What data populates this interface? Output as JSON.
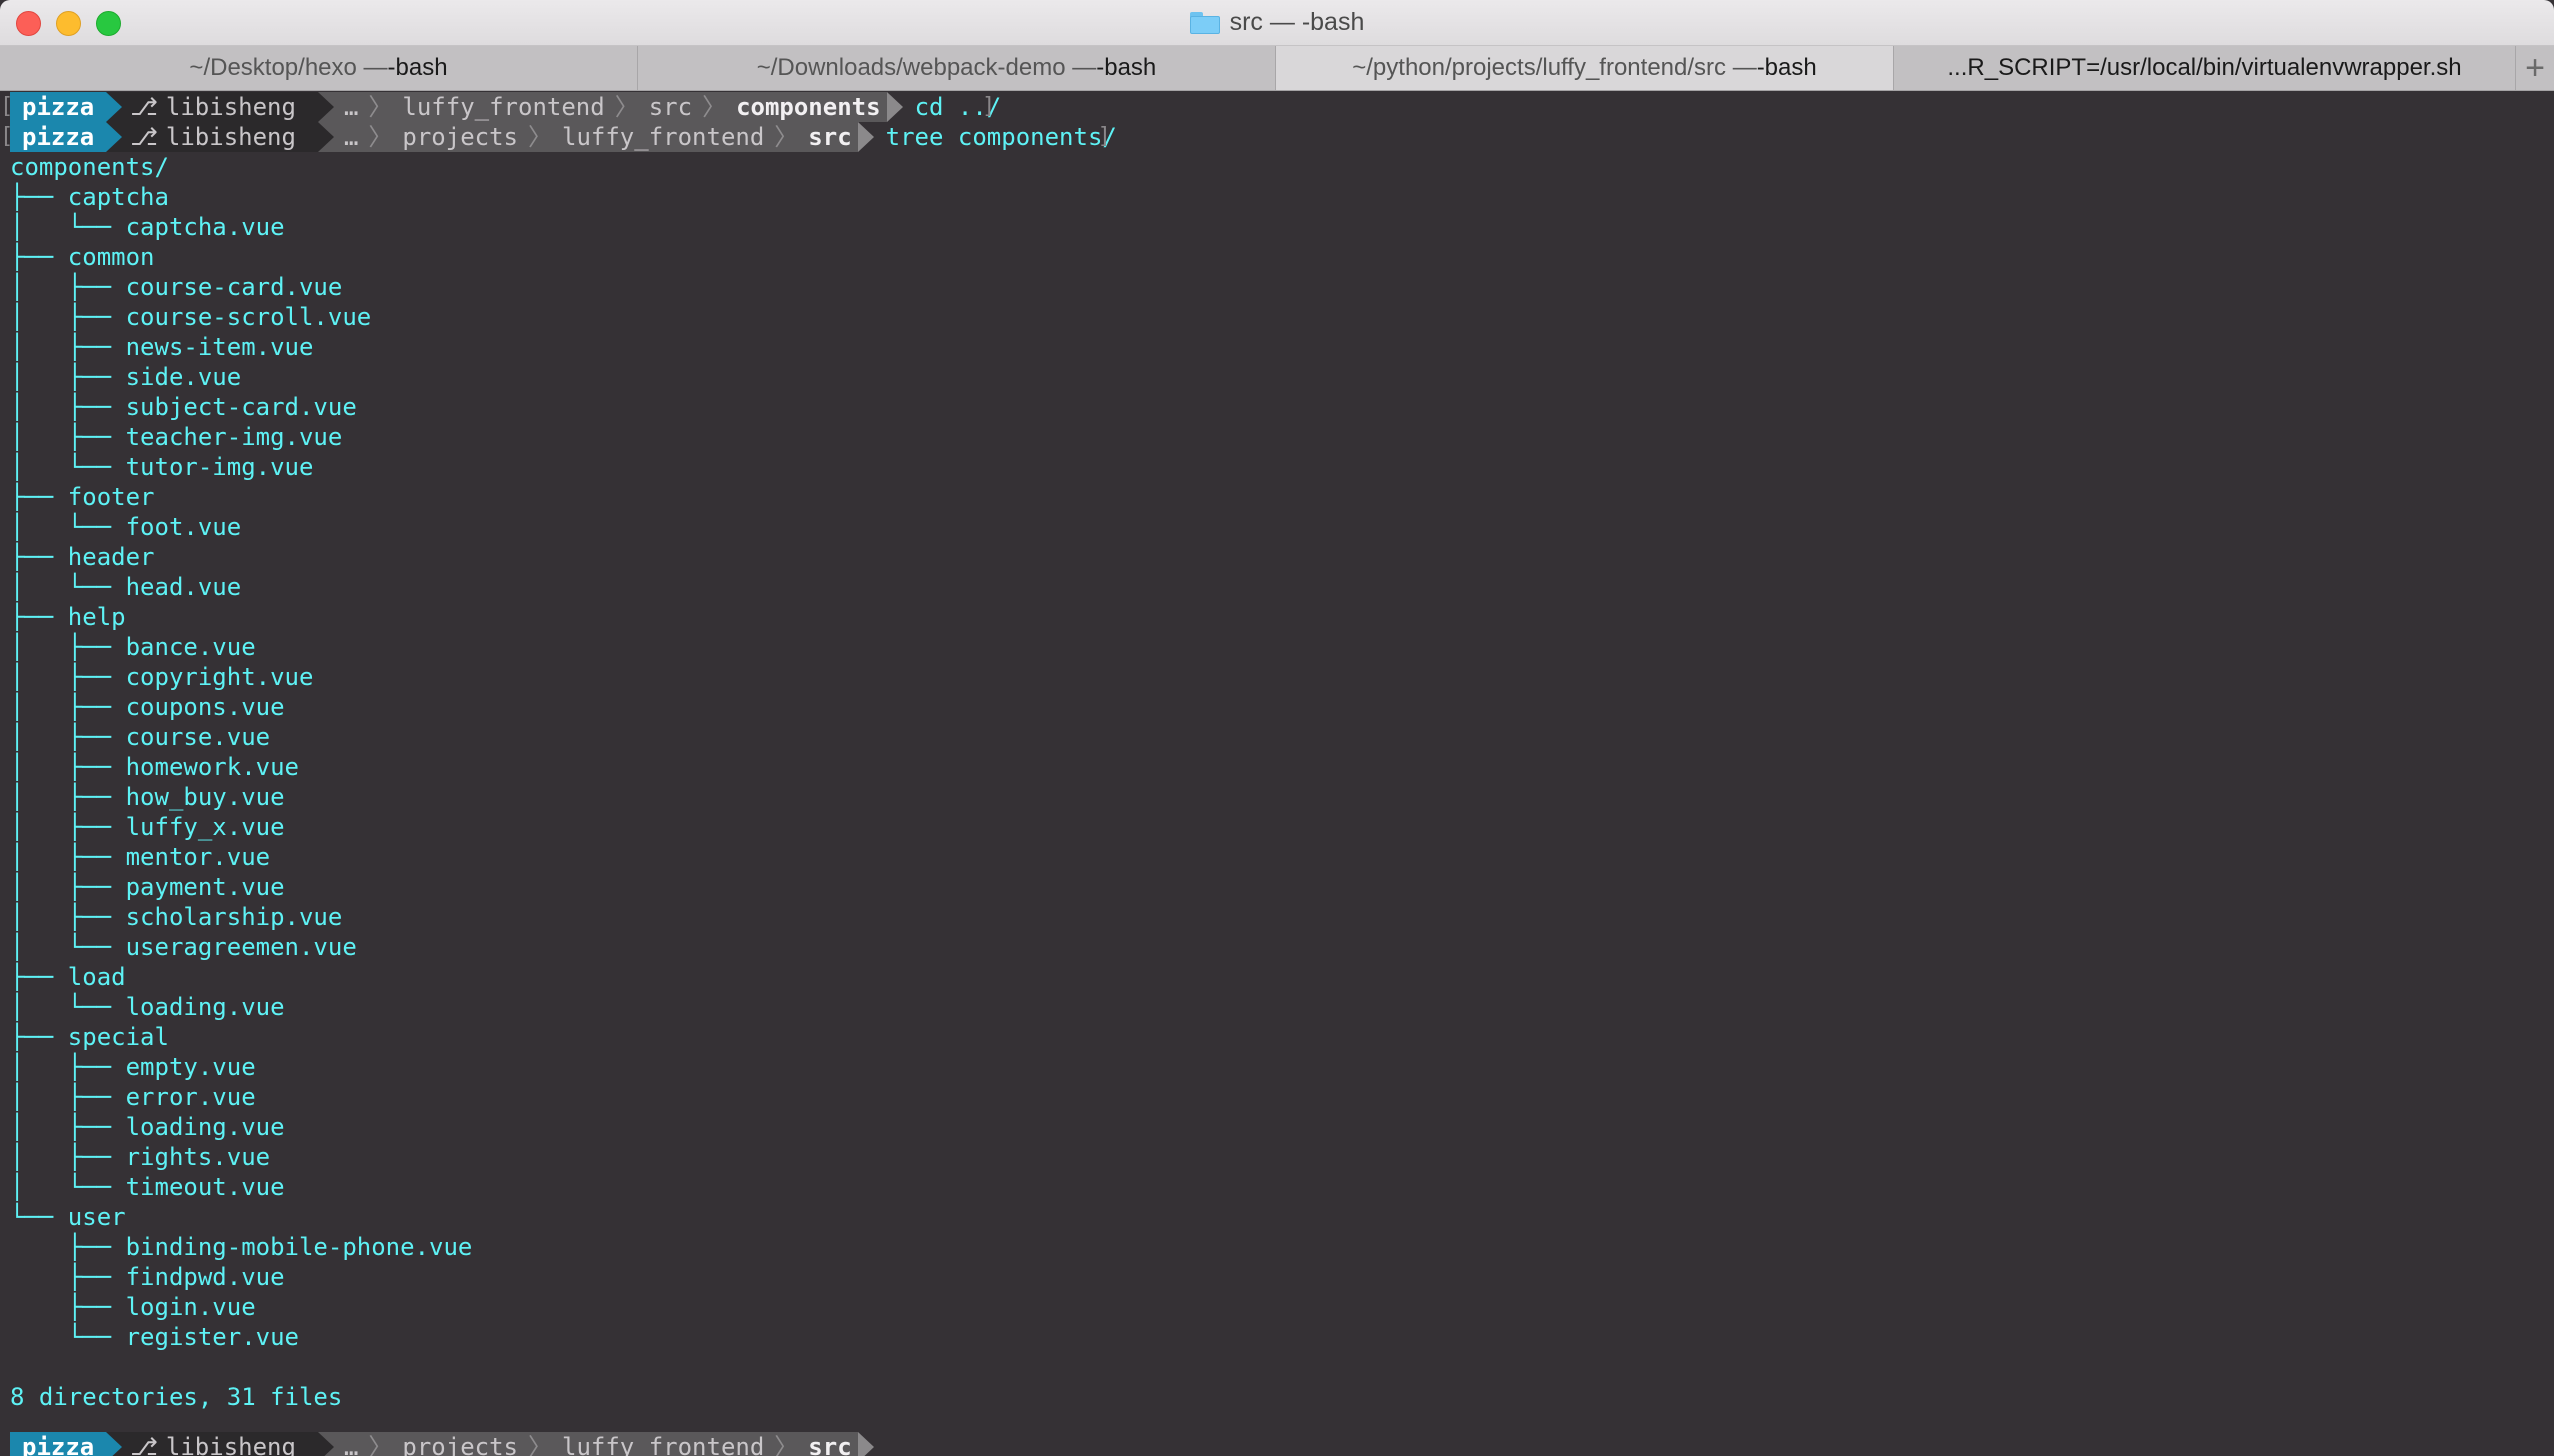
{
  "window": {
    "title": "src — -bash",
    "title_icon": "folder-icon"
  },
  "tabs": [
    {
      "path": "~/Desktop/hexo — ",
      "cmd": "-bash",
      "active": false
    },
    {
      "path": "~/Downloads/webpack-demo — ",
      "cmd": "-bash",
      "active": false
    },
    {
      "path": "~/python/projects/luffy_frontend/src — ",
      "cmd": "-bash",
      "active": true
    },
    {
      "path": "...R_SCRIPT=/usr/local/bin/virtualenvwrapper.sh",
      "cmd": "",
      "active": false
    }
  ],
  "new_tab_label": "+",
  "prompts": [
    {
      "user": "pizza",
      "git_icon": "git-branch-icon",
      "git": "libisheng",
      "path": [
        "…",
        "luffy_frontend",
        "src"
      ],
      "current": "components",
      "command": "cd ../"
    },
    {
      "user": "pizza",
      "git_icon": "git-branch-icon",
      "git": "libisheng",
      "path": [
        "…",
        "projects",
        "luffy_frontend"
      ],
      "current": "src",
      "command": "tree components/"
    }
  ],
  "tree_output": [
    "components/",
    "├── captcha",
    "│   └── captcha.vue",
    "├── common",
    "│   ├── course-card.vue",
    "│   ├── course-scroll.vue",
    "│   ├── news-item.vue",
    "│   ├── side.vue",
    "│   ├── subject-card.vue",
    "│   ├── teacher-img.vue",
    "│   └── tutor-img.vue",
    "├── footer",
    "│   └── foot.vue",
    "├── header",
    "│   └── head.vue",
    "├── help",
    "│   ├── bance.vue",
    "│   ├── copyright.vue",
    "│   ├── coupons.vue",
    "│   ├── course.vue",
    "│   ├── homework.vue",
    "│   ├── how_buy.vue",
    "│   ├── luffy_x.vue",
    "│   ├── mentor.vue",
    "│   ├── payment.vue",
    "│   ├── scholarship.vue",
    "│   └── useragreemen.vue",
    "├── load",
    "│   └── loading.vue",
    "├── special",
    "│   ├── empty.vue",
    "│   ├── error.vue",
    "│   ├── loading.vue",
    "│   ├── rights.vue",
    "│   └── timeout.vue",
    "└── user",
    "    ├── binding-mobile-phone.vue",
    "    ├── findpwd.vue",
    "    ├── login.vue",
    "    └── register.vue",
    "",
    "8 directories, 31 files"
  ],
  "final_prompt": {
    "user": "pizza",
    "git_icon": "git-branch-icon",
    "git": "libisheng",
    "path": [
      "…",
      "projects",
      "luffy_frontend"
    ],
    "current": "src",
    "command": ""
  },
  "colors": {
    "terminal_bg": "#353135",
    "output_text": "#5ef2f5",
    "user_segment": "#1b87ad",
    "git_segment": "#2b292b",
    "path_segment": "#5a585a",
    "cursor": "#1f8c1f"
  }
}
